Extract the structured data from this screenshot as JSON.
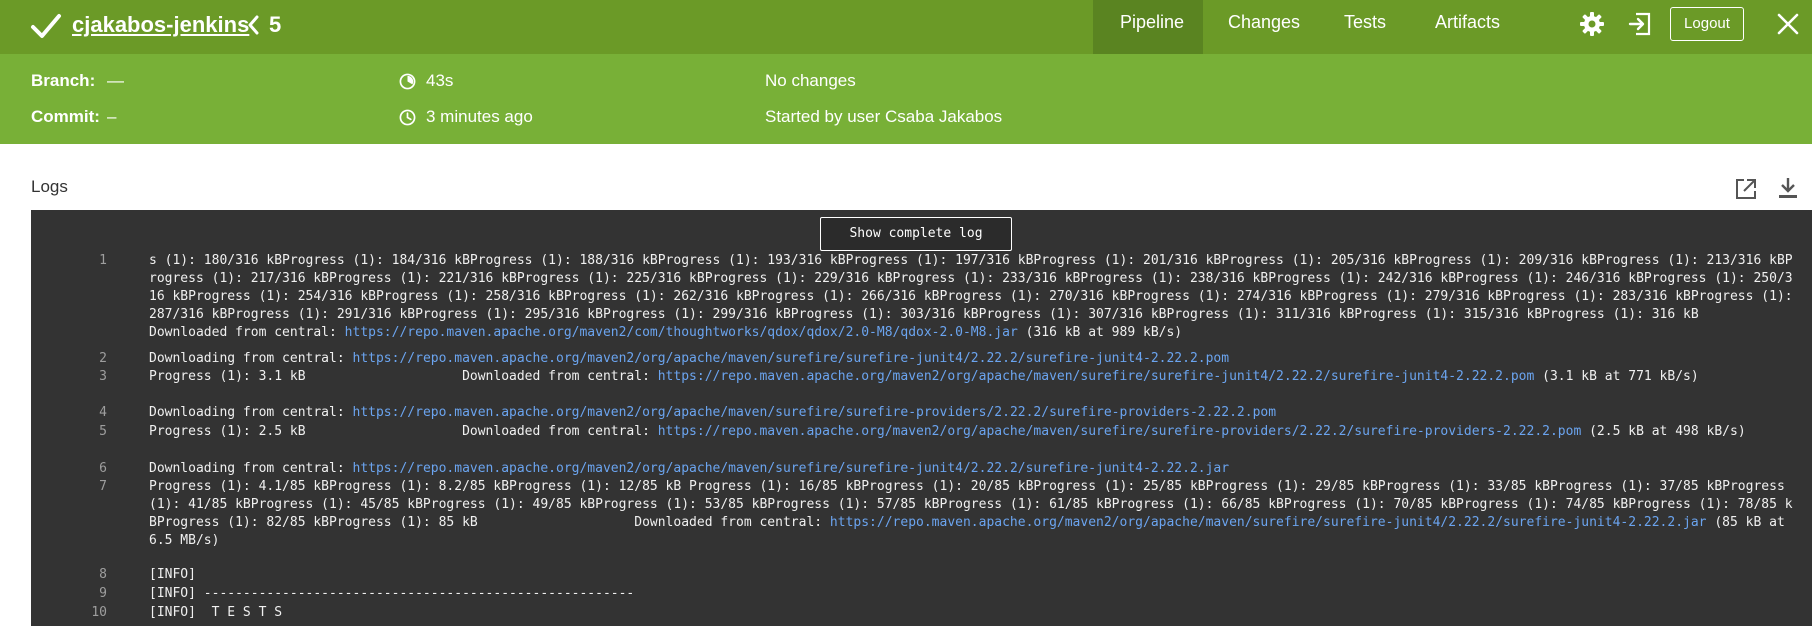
{
  "header": {
    "job_name": "cjakabos-jenkins",
    "separator": "<",
    "run_number": "5",
    "tabs": [
      "Pipeline",
      "Changes",
      "Tests",
      "Artifacts"
    ],
    "logout_label": "Logout",
    "icons": [
      "check-icon",
      "gear-icon",
      "exit-icon",
      "close-icon"
    ]
  },
  "summary": {
    "branch_label": "Branch:",
    "branch_value": "—",
    "commit_label": "Commit:",
    "commit_value": "–",
    "duration": "43s",
    "time_ago": "3 minutes ago",
    "changes": "No changes",
    "started_by": "Started by user Csaba Jakabos"
  },
  "logs": {
    "title": "Logs",
    "show_complete_log": "Show complete log",
    "lines": [
      {
        "num": "1",
        "text": "s (1): 180/316 kBProgress (1): 184/316 kBProgress (1): 188/316 kBProgress (1): 193/316 kBProgress (1): 197/316 kBProgress (1): 201/316 kBProgress (1): 205/316 kBProgress (1): 209/316 kBProgress (1): 213/316 kBProgress (1): 217/316 kBProgress (1): 221/316 kBProgress (1): 225/316 kBProgress (1): 229/316 kBProgress (1): 233/316 kBProgress (1): 238/316 kBProgress (1): 242/316 kBProgress (1): 246/316 kBProgress (1): 250/316 kBProgress (1): 254/316 kBProgress (1): 258/316 kBProgress (1): 262/316 kBProgress (1): 266/316 kBProgress (1): 270/316 kBProgress (1): 274/316 kBProgress (1): 279/316 kBProgress (1): 283/316 kBProgress (1): 287/316 kBProgress (1): 291/316 kBProgress (1): 295/316 kBProgress (1): 299/316 kBProgress (1): 303/316 kBProgress (1): 307/316 kBProgress (1): 311/316 kBProgress (1): 315/316 kBProgress (1): 316 kB                    Downloaded from central: ",
        "link": "https://repo.maven.apache.org/maven2/com/thoughtworks/qdox/qdox/2.0-M8/qdox-2.0-M8.jar",
        "after": " (316 kB at 989 kB/s)"
      },
      {
        "num": "2",
        "text": "Downloading from central: ",
        "link": "https://repo.maven.apache.org/maven2/org/apache/maven/surefire/surefire-junit4/2.22.2/surefire-junit4-2.22.2.pom",
        "after": ""
      },
      {
        "num": "3",
        "text": "Progress (1): 3.1 kB                    Downloaded from central: ",
        "link": "https://repo.maven.apache.org/maven2/org/apache/maven/surefire/surefire-junit4/2.22.2/surefire-junit4-2.22.2.pom",
        "after": " (3.1 kB at 771 kB/s)"
      },
      {
        "num": "4",
        "text": "Downloading from central: ",
        "link": "https://repo.maven.apache.org/maven2/org/apache/maven/surefire/surefire-providers/2.22.2/surefire-providers-2.22.2.pom",
        "after": ""
      },
      {
        "num": "5",
        "text": "Progress (1): 2.5 kB                    Downloaded from central: ",
        "link": "https://repo.maven.apache.org/maven2/org/apache/maven/surefire/surefire-providers/2.22.2/surefire-providers-2.22.2.pom",
        "after": " (2.5 kB at 498 kB/s)"
      },
      {
        "num": "6",
        "text": "Downloading from central: ",
        "link": "https://repo.maven.apache.org/maven2/org/apache/maven/surefire/surefire-junit4/2.22.2/surefire-junit4-2.22.2.jar",
        "after": ""
      },
      {
        "num": "7",
        "text": "Progress (1): 4.1/85 kBProgress (1): 8.2/85 kBProgress (1): 12/85 kB Progress (1): 16/85 kBProgress (1): 20/85 kBProgress (1): 25/85 kBProgress (1): 29/85 kBProgress (1): 33/85 kBProgress (1): 37/85 kBProgress (1): 41/85 kBProgress (1): 45/85 kBProgress (1): 49/85 kBProgress (1): 53/85 kBProgress (1): 57/85 kBProgress (1): 61/85 kBProgress (1): 66/85 kBProgress (1): 70/85 kBProgress (1): 74/85 kBProgress (1): 78/85 kBProgress (1): 82/85 kBProgress (1): 85 kB                    Downloaded from central: ",
        "link": "https://repo.maven.apache.org/maven2/org/apache/maven/surefire/surefire-junit4/2.22.2/surefire-junit4-2.22.2.jar",
        "after": " (85 kB at 6.5 MB/s)"
      },
      {
        "num": "8",
        "text": "[INFO]",
        "link": "",
        "after": ""
      },
      {
        "num": "9",
        "text": "[INFO] -------------------------------------------------------",
        "link": "",
        "after": ""
      },
      {
        "num": "10",
        "text": "[INFO]  T E S T S",
        "link": "",
        "after": ""
      }
    ]
  }
}
